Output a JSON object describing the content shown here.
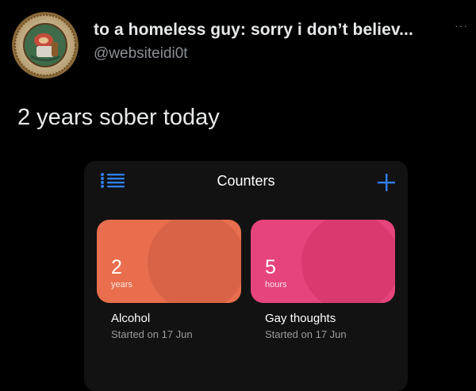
{
  "tweet": {
    "display_name": "to a homeless guy: sorry i don’t believ...",
    "handle": "@websiteidi0t",
    "more_label": "···",
    "text": "2 years sober today"
  },
  "app": {
    "title": "Counters",
    "menu_icon": "list-icon",
    "add_icon": "plus-icon",
    "accent": "#2f7ff2",
    "counters": [
      {
        "value": "2",
        "unit": "years",
        "name": "Alcohol",
        "started": "Started on 17 Jun",
        "color": "#e86e4e"
      },
      {
        "value": "5",
        "unit": "hours",
        "name": "Gay thoughts",
        "started": "Started on 17 Jun",
        "color": "#e5447c"
      }
    ]
  }
}
